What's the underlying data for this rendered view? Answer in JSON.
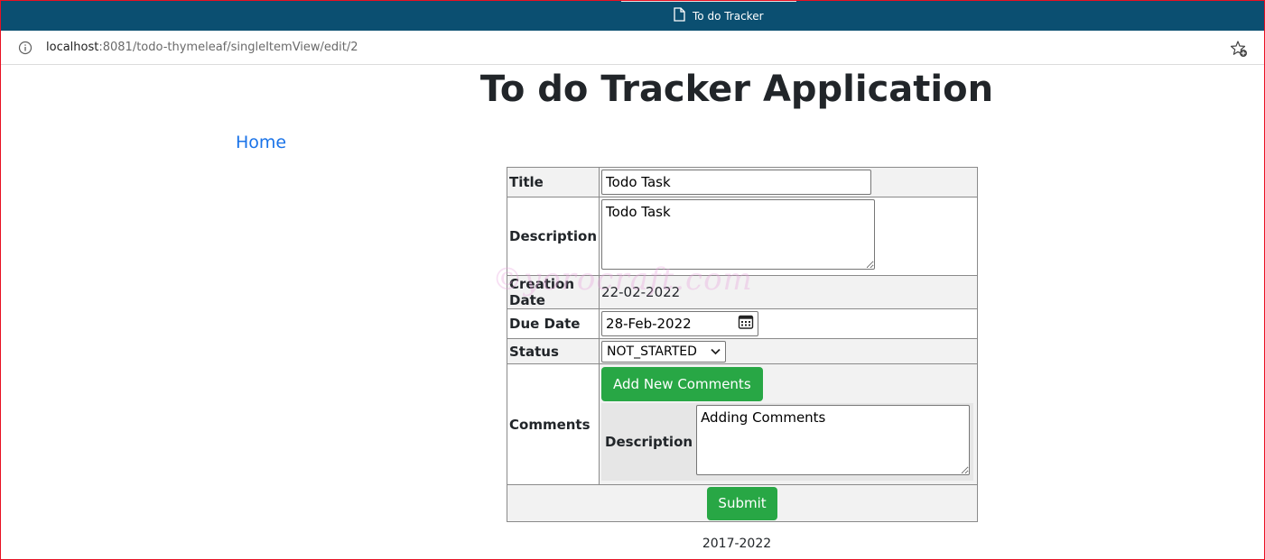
{
  "browser": {
    "tab_title": "To do Tracker",
    "url_host": "localhost",
    "url_path": ":8081/todo-thymeleaf/singleItemView/edit/2",
    "icons": {
      "page": "page-icon",
      "info": "info-icon",
      "favorite": "add-favorite-icon"
    }
  },
  "header": {
    "title": "To do Tracker Application"
  },
  "nav": {
    "home_label": "Home"
  },
  "form": {
    "title_label": "Title",
    "title_value": "Todo Task",
    "description_label": "Description",
    "description_value": "Todo Task",
    "creation_date_label": "Creation Date",
    "creation_date_value": "22-02-2022",
    "due_date_label": "Due Date",
    "due_date_value": "28-Feb-2022",
    "status_label": "Status",
    "status_value": "NOT_STARTED",
    "comments_label": "Comments",
    "add_comments_label": "Add New Comments",
    "comment_description_label": "Description",
    "comment_description_value": "Adding Comments",
    "submit_label": "Submit"
  },
  "watermark": {
    "text": "©yorocraft.com"
  },
  "footer": {
    "text": "2017-2022"
  },
  "colors": {
    "titlebar": "#0b4f71",
    "accent_green": "#28a745",
    "link_blue": "#1a73e8",
    "frame_red": "#e81123"
  }
}
